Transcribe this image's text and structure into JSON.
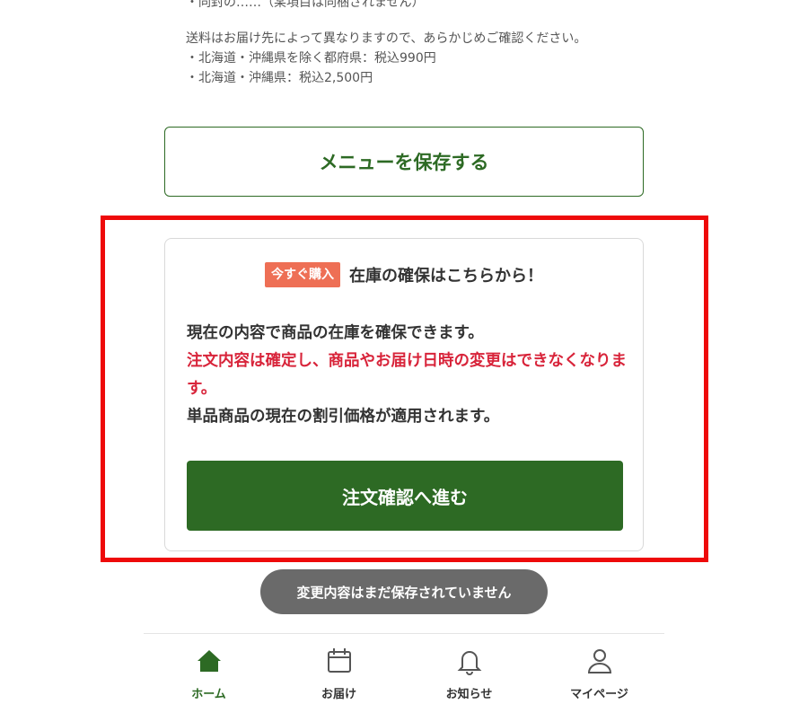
{
  "top": {
    "cut_line": "・同封の……（某項目は同梱されません）"
  },
  "shipping": {
    "note": "送料はお届け先によって異なりますので、あらかじめご確認ください。",
    "line1": "・北海道・沖縄県を除く都府県：税込990円",
    "line2": "・北海道・沖縄県：税込2,500円"
  },
  "save_menu": {
    "label": "メニューを保存する"
  },
  "purchase_card": {
    "badge": "今すぐ購入",
    "title": "在庫の確保はこちらから！",
    "line1": "現在の内容で商品の在庫を確保できます。",
    "warning": "注文内容は確定し、商品やお届け日時の変更はできなくなります。",
    "line3": "単品商品の現在の割引価格が適用されます。",
    "button": "注文確認へ進む"
  },
  "toast": {
    "text": "変更内容はまだ保存されていません"
  },
  "tabbar": {
    "items": [
      {
        "label": "ホーム",
        "icon": "home-icon",
        "active": true
      },
      {
        "label": "お届け",
        "icon": "calendar-icon",
        "active": false
      },
      {
        "label": "お知らせ",
        "icon": "bell-icon",
        "active": false
      },
      {
        "label": "マイページ",
        "icon": "user-icon",
        "active": false
      }
    ]
  },
  "colors": {
    "brand_green": "#2d6a24",
    "highlight_red": "#ee0a0a",
    "badge_orange": "#ee6f55",
    "warning_red": "#d8243a",
    "toast_gray": "#6a6a6a"
  }
}
